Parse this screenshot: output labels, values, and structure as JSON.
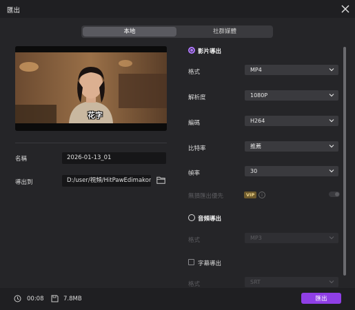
{
  "window": {
    "title": "匯出"
  },
  "tabs": {
    "local": "本地",
    "social": "社群媒體"
  },
  "preview": {
    "subtitle_text": "花字"
  },
  "left": {
    "name_label": "名稱",
    "name_value": "2026-01-13_01",
    "export_to_label": "導出到",
    "export_to_value": "D:/user/視頻/HitPawEdimakor"
  },
  "video_section": {
    "title": "影片導出",
    "selected": true,
    "format_label": "格式",
    "format_value": "MP4",
    "resolution_label": "解析度",
    "resolution_value": "1080P",
    "codec_label": "編碼",
    "codec_value": "H264",
    "bitrate_label": "比特率",
    "bitrate_value": "推薦",
    "framerate_label": "幀率",
    "framerate_value": "30",
    "lossless_label": "無損匯出優先",
    "vip_badge": "VIP",
    "info_icon": "i"
  },
  "audio_section": {
    "title": "音頻導出",
    "selected": false,
    "format_label": "格式",
    "format_value": "MP3"
  },
  "subtitle_section": {
    "label": "字幕導出",
    "format_label": "格式",
    "format_value": "SRT"
  },
  "footer": {
    "duration": "00:08",
    "size": "7.8MB",
    "export_label": "匯出"
  },
  "colors": {
    "accent": "#8f3fe6",
    "radio": "#b078ff",
    "background": "#252528",
    "vip": "#6e5a2d"
  },
  "icons": [
    "close-icon",
    "folder-icon",
    "chevron-down-icon",
    "clock-icon",
    "save-icon",
    "info-icon"
  ]
}
